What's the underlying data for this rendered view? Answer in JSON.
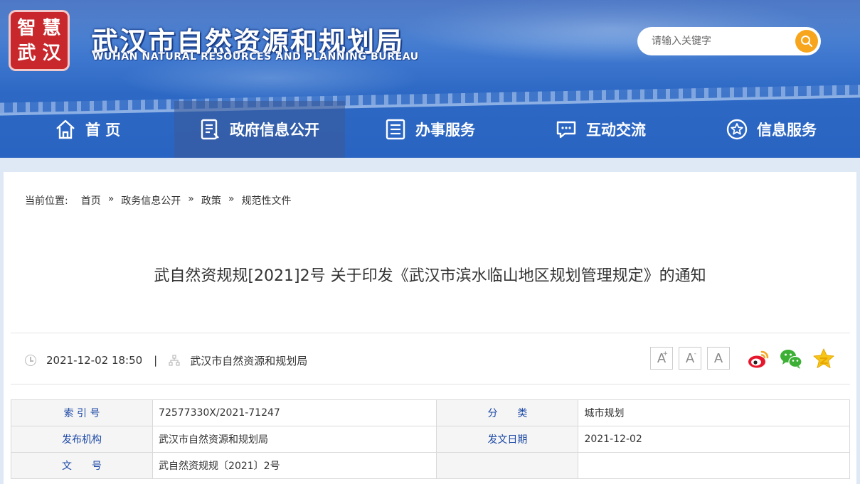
{
  "header": {
    "seal_chars": [
      "智",
      "慧",
      "武",
      "汉"
    ],
    "title": "武汉市自然资源和规划局",
    "subtitle": "WUHAN NATURAL RESOURCES AND PLANNING BUREAU",
    "search": {
      "placeholder": "请输入关键字",
      "icon": "search-icon"
    }
  },
  "nav": {
    "items": [
      {
        "label": "首 页",
        "icon": "home-icon",
        "active": false
      },
      {
        "label": "政府信息公开",
        "icon": "document-icon",
        "active": true
      },
      {
        "label": "办事服务",
        "icon": "list-icon",
        "active": false
      },
      {
        "label": "互动交流",
        "icon": "chat-icon",
        "active": false
      },
      {
        "label": "信息服务",
        "icon": "star-icon",
        "active": false
      }
    ]
  },
  "breadcrumb": {
    "label": "当前位置:",
    "items": [
      "首页",
      "政务信息公开",
      "政策",
      "规范性文件"
    ],
    "separator": "»"
  },
  "article": {
    "title": "武自然资规规[2021]2号 关于印发《武汉市滨水临山地区规划管理规定》的通知",
    "datetime": "2021-12-02 18:50",
    "divider": "|",
    "publisher": "武汉市自然资源和规划局"
  },
  "font_size": {
    "larger": "A",
    "smaller": "A",
    "normal": "A",
    "plus": "+",
    "minus": "-"
  },
  "share": [
    "weibo-icon",
    "wechat-icon",
    "qzone-icon"
  ],
  "info_table": {
    "rows": [
      {
        "k1": "索 引 号",
        "v1": "72577330X/2021-71247",
        "k2": "分　　类",
        "v2": "城市规划"
      },
      {
        "k1": "发布机构",
        "v1": "武汉市自然资源和规划局",
        "k2": "发文日期",
        "v2": "2021-12-02"
      },
      {
        "k1": "文　　号",
        "v1": "武自然资规规〔2021〕2号",
        "k2": "",
        "v2": ""
      }
    ]
  },
  "colors": {
    "nav_blue": "#2c68c4",
    "seal_red": "#c8282c",
    "search_orange": "#f7a51c",
    "link_blue": "#1a47a5"
  }
}
